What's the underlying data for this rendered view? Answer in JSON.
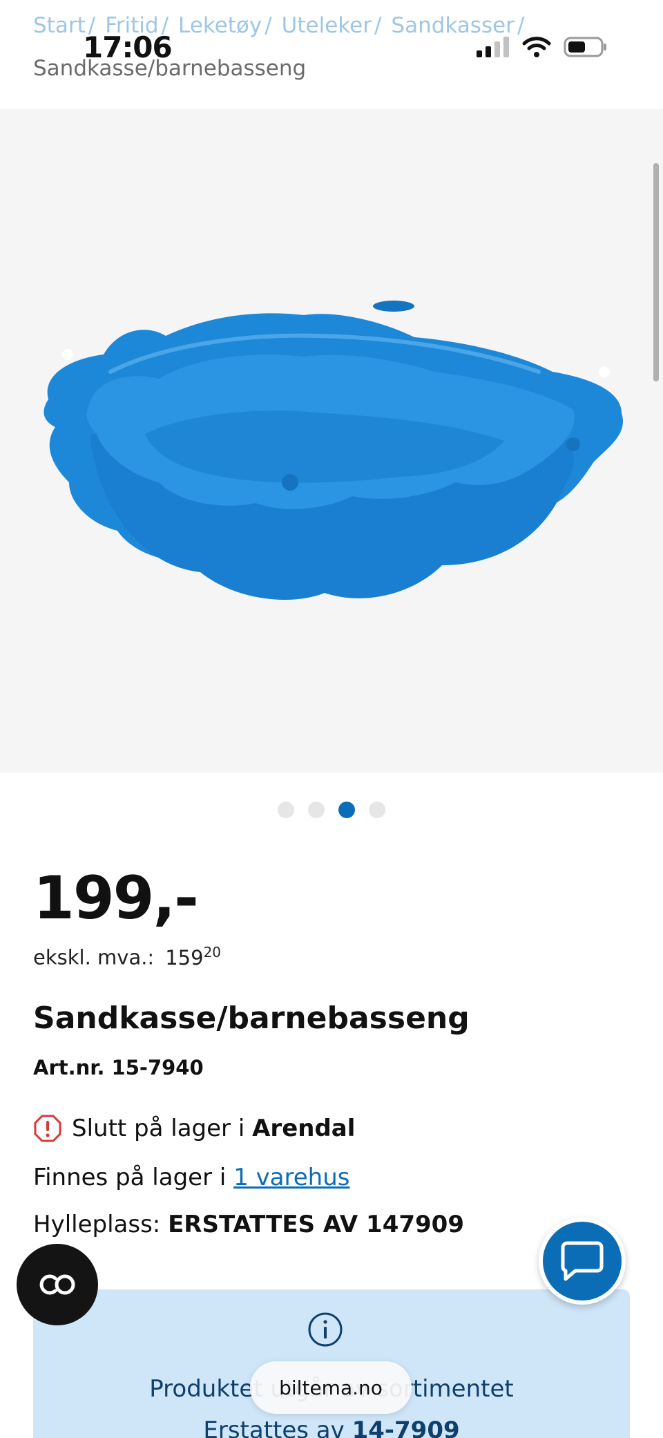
{
  "status_bar": {
    "time": "17:06"
  },
  "breadcrumb": {
    "items": [
      "Start",
      "Fritid",
      "Leketøy",
      "Uteleker",
      "Sandkasser"
    ],
    "separator": "/",
    "current": "Sandkasse/barnebasseng"
  },
  "gallery": {
    "total_images": 4,
    "active_index": 3
  },
  "product": {
    "price": "199,-",
    "ex_vat_label": "ekskl. mva.:",
    "ex_vat_main": "159",
    "ex_vat_cents": "20",
    "name": "Sandkasse/barnebasseng",
    "article_number": "Art.nr. 15-7940"
  },
  "stock": {
    "out_prefix": "Slutt på lager i",
    "out_store": "Arendal",
    "in_prefix": "Finnes på lager i",
    "in_link": "1 varehus",
    "shelf_label": "Hylleplass:",
    "shelf_value": "ERSTATTES AV 147909"
  },
  "info_panel": {
    "line1": "Produktet utgår av sortimentet",
    "line2_prefix": "Erstattes av",
    "line2_value": "14-7909"
  },
  "browser": {
    "url": "biltema.no"
  },
  "colors": {
    "brand_blue": "#0b6db5",
    "breadcrumb_link": "#9ec7e6",
    "info_bg": "#cfe6f9",
    "product_blue": "#1e88d8",
    "warning_red": "#d23a3a"
  },
  "icons": {
    "warning": "exclamation-circle-icon",
    "chat": "chat-bubble-icon",
    "info": "info-circle-icon",
    "co": "co-logo-icon"
  }
}
